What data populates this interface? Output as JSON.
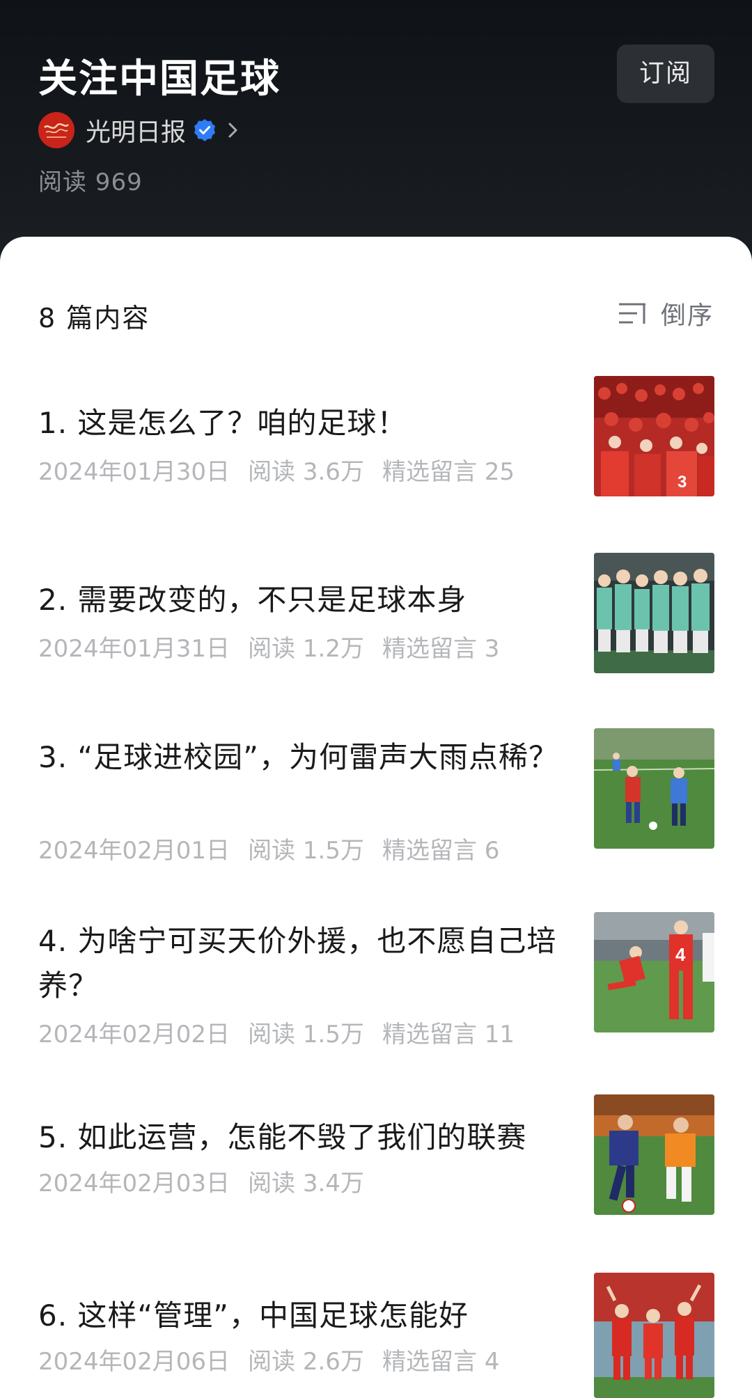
{
  "header": {
    "title": "关注中国足球",
    "subscribe_label": "订阅",
    "author": {
      "name": "光明日报",
      "avatar_text": "光明日报",
      "verified": true
    },
    "read_count": "阅读 969"
  },
  "list": {
    "count_label": "8 篇内容",
    "sort_label": "倒序",
    "articles": [
      {
        "title": "1. 这是怎么了？咱的足球！",
        "date": "2024年01月30日",
        "reads": "阅读 3.6万",
        "comments": "精选留言 25"
      },
      {
        "title": "2. 需要改变的，不只是足球本身",
        "date": "2024年01月31日",
        "reads": "阅读 1.2万",
        "comments": "精选留言 3"
      },
      {
        "title": "3. “足球进校园”，为何雷声大雨点稀？",
        "date": "2024年02月01日",
        "reads": "阅读 1.5万",
        "comments": "精选留言 6"
      },
      {
        "title": "4. 为啥宁可买天价外援，也不愿自己培养？",
        "date": "2024年02月02日",
        "reads": "阅读 1.5万",
        "comments": "精选留言 11"
      },
      {
        "title": "5. 如此运营，怎能不毁了我们的联赛",
        "date": "2024年02月03日",
        "reads": "阅读 3.4万",
        "comments": ""
      },
      {
        "title": "6. 这样“管理”，中国足球怎能好",
        "date": "2024年02月06日",
        "reads": "阅读 2.6万",
        "comments": "精选留言 4"
      }
    ]
  },
  "colors": {
    "header_bg": "#14181c",
    "meta_text": "#b4b6b9",
    "verified_blue": "#2f7cf6",
    "brand_red": "#c8241a"
  }
}
